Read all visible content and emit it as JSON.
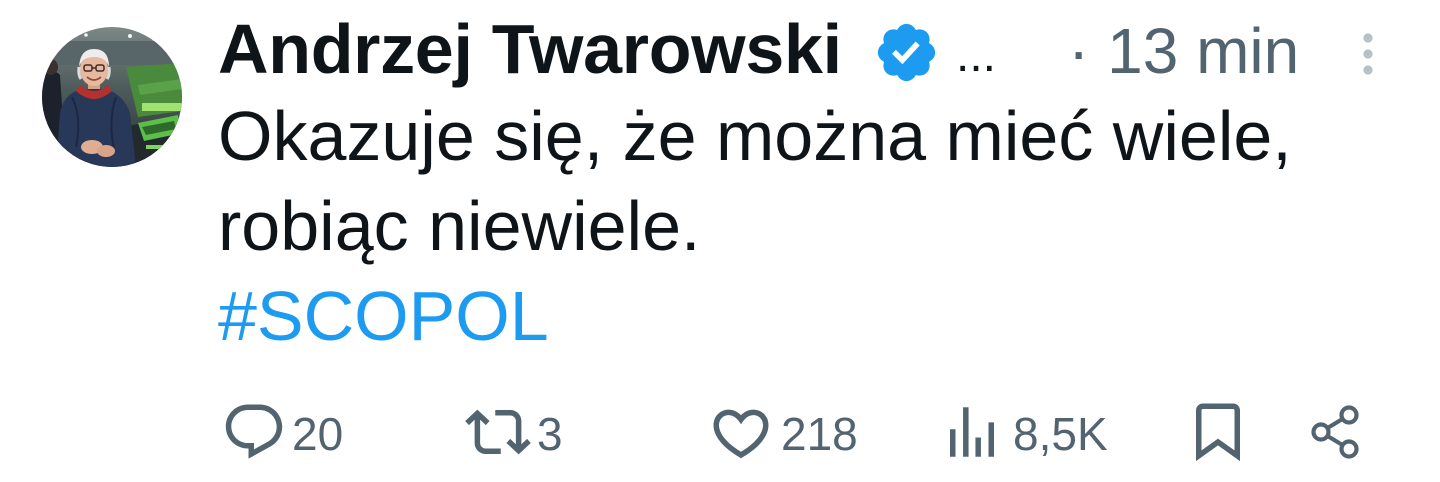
{
  "author": {
    "name": "Andrzej Twarowski",
    "verified": true,
    "handle": "...",
    "separator": "·",
    "time": "13 min"
  },
  "tweet": {
    "text_lines": [
      "Okazuje się, że można mieć wiele,",
      "robiąc niewiele."
    ],
    "hashtag": "#SCOPOL"
  },
  "actions": {
    "replies": "20",
    "reposts": "3",
    "likes": "218",
    "views": "8,5K"
  },
  "icons": {
    "verified": "verified-badge-icon",
    "more": "more-vertical-icon",
    "reply": "reply-icon",
    "repost": "repost-icon",
    "like": "heart-icon",
    "views": "views-icon",
    "bookmark": "bookmark-icon",
    "share": "share-icon"
  },
  "colors": {
    "background": "#ffffff",
    "text": "#0f1419",
    "secondary": "#536471",
    "link": "#1d9bf0",
    "verified": "#1d9bf0",
    "more": "#b6c0c8"
  }
}
